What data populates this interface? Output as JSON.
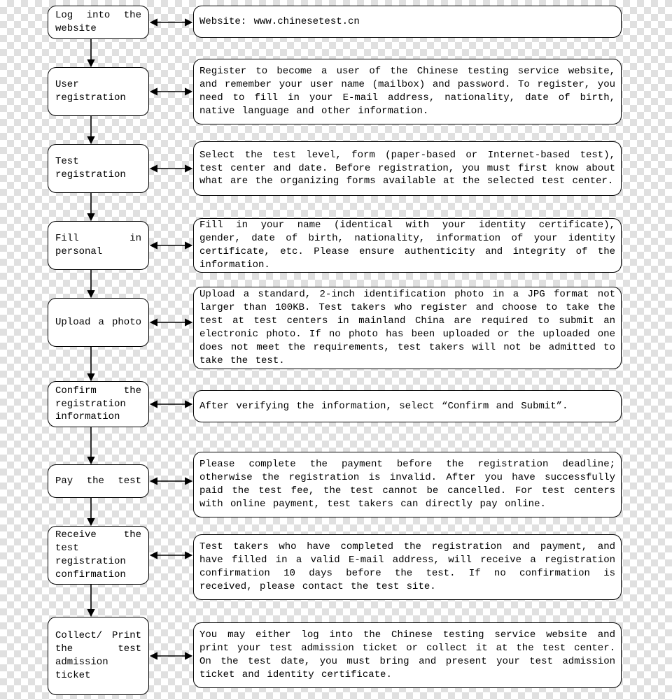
{
  "diagram": {
    "type": "flowchart",
    "direction": "top-to-bottom",
    "steps": [
      {
        "label": "Log into the website",
        "description": "Website: www.chinesetest.cn"
      },
      {
        "label": "User registration",
        "description": "Register to become a user of the Chinese testing service website, and remember your user name (mailbox) and password. To register, you need to fill in your E-mail address, nationality, date of birth, native language and other information."
      },
      {
        "label": "Test registration",
        "description": "Select the test level, form (paper-based or Internet-based test), test center and date. Before registration, you must first know about what are the organizing forms available at the selected test center."
      },
      {
        "label": "Fill in personal",
        "description": "Fill in your name (identical with your identity certificate), gender, date of birth, nationality, information of your identity certificate, etc. Please ensure authenticity and integrity of the information."
      },
      {
        "label": "Upload a photo",
        "description": "Upload a standard, 2-inch identification photo in a JPG format not larger than 100KB.\nTest takers who register and choose to take the test at test centers in mainland China are required to submit an electronic photo. If no photo has been uploaded or the uploaded one does not meet the requirements, test takers will not be admitted to take the test."
      },
      {
        "label": "Confirm the registration information",
        "description": "After verifying the information, select “Confirm and Submit”."
      },
      {
        "label": "Pay the test",
        "description": "Please complete the payment before the registration deadline; otherwise the registration is invalid. After you have successfully paid the test fee, the test cannot be cancelled.\nFor test centers with online payment, test takers can directly pay online."
      },
      {
        "label": "Receive the test registration confirmation",
        "description": "Test takers who have completed the registration and payment, and have filled in a valid E-mail address, will receive a registration confirmation 10 days before the test. If no confirmation is received, please contact the test site."
      },
      {
        "label": "Collect/ Print the test admission ticket",
        "description": "You may either log into the Chinese testing service website and print your test admission ticket or collect it at the test center. On the test date, you must bring and present your test admission ticket and identity certificate."
      }
    ]
  }
}
